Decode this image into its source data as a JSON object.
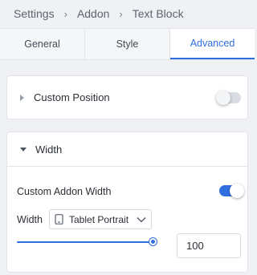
{
  "breadcrumb": {
    "items": [
      "Settings",
      "Addon",
      "Text Block"
    ]
  },
  "tabs": [
    {
      "label": "General",
      "active": false
    },
    {
      "label": "Style",
      "active": false
    },
    {
      "label": "Advanced",
      "active": true
    }
  ],
  "custom_position": {
    "label": "Custom Position",
    "expanded": false,
    "toggle_on": false
  },
  "width_panel": {
    "label": "Width",
    "expanded": true,
    "custom_addon_width": {
      "label": "Custom Addon Width",
      "toggle_on": true
    },
    "width_label": "Width",
    "device": {
      "selected": "Tablet Portrait",
      "icon": "tablet-icon"
    },
    "slider_value_fraction": 1.0,
    "value": "100"
  },
  "colors": {
    "accent": "#2f6fe0",
    "background": "#f0f1f4",
    "panel": "#ffffff"
  }
}
